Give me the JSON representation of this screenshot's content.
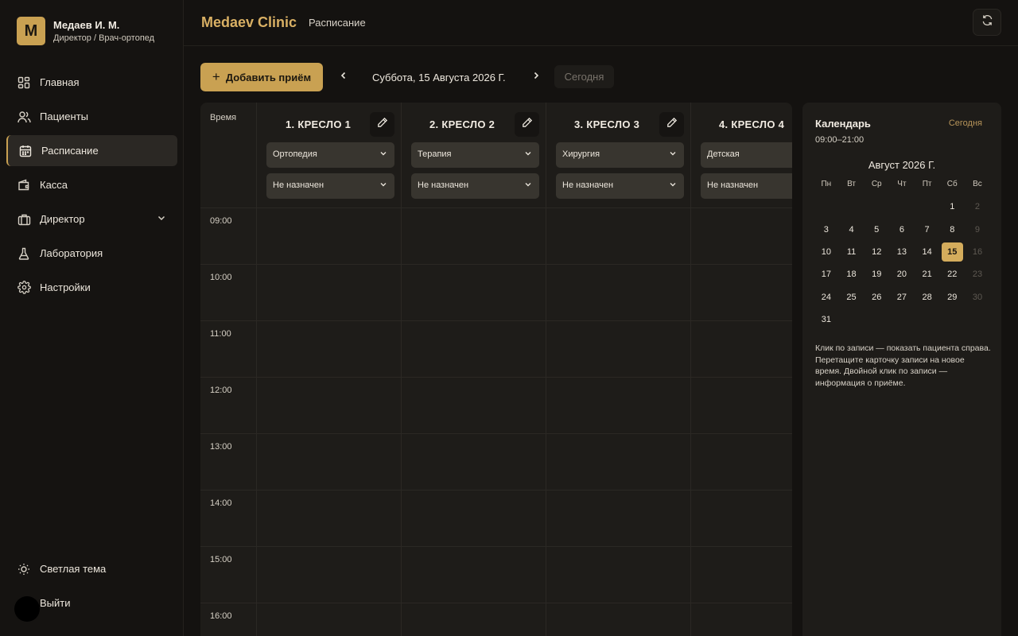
{
  "user": {
    "avatar_letter": "M",
    "name": "Медаев И. М.",
    "role": "Директор / Врач-ортопед"
  },
  "sidebar": {
    "items": [
      {
        "label": "Главная",
        "icon": "dashboard-icon"
      },
      {
        "label": "Пациенты",
        "icon": "users-icon"
      },
      {
        "label": "Расписание",
        "icon": "calendar-icon",
        "active": true
      },
      {
        "label": "Касса",
        "icon": "wallet-icon"
      },
      {
        "label": "Директор",
        "icon": "briefcase-icon",
        "expandable": true
      },
      {
        "label": "Лаборатория",
        "icon": "flask-icon"
      },
      {
        "label": "Настройки",
        "icon": "gear-icon"
      }
    ],
    "theme_label": "Светлая тема",
    "logout_label": "Выйти"
  },
  "header": {
    "brand": "Medaev Clinic",
    "breadcrumb": "Расписание"
  },
  "toolbar": {
    "add_label": "Добавить приём",
    "date_label": "Суббота, 15 Августа 2026 Г.",
    "today_label": "Сегодня"
  },
  "schedule": {
    "time_header": "Время",
    "chairs": [
      {
        "title": "1. КРЕСЛО 1",
        "specialty": "Ортопедия",
        "doctor": "Не назначен"
      },
      {
        "title": "2. КРЕСЛО 2",
        "specialty": "Терапия",
        "doctor": "Не назначен"
      },
      {
        "title": "3. КРЕСЛО 3",
        "specialty": "Хирургия",
        "doctor": "Не назначен"
      },
      {
        "title": "4. КРЕСЛО 4",
        "specialty": "Детская",
        "doctor": "Не назначен"
      }
    ],
    "hours": [
      "09:00",
      "10:00",
      "11:00",
      "12:00",
      "13:00",
      "14:00",
      "15:00",
      "16:00"
    ]
  },
  "calendar": {
    "title": "Календарь",
    "today_label": "Сегодня",
    "hours": "09:00–21:00",
    "month": "Август 2026 Г.",
    "weekdays": [
      "Пн",
      "Вт",
      "Ср",
      "Чт",
      "Пт",
      "Сб",
      "Вс"
    ],
    "weeks": [
      [
        "",
        "",
        "",
        "",
        "",
        "1",
        "2"
      ],
      [
        "3",
        "4",
        "5",
        "6",
        "7",
        "8",
        "9"
      ],
      [
        "10",
        "11",
        "12",
        "13",
        "14",
        "15",
        "16"
      ],
      [
        "17",
        "18",
        "19",
        "20",
        "21",
        "22",
        "23"
      ],
      [
        "24",
        "25",
        "26",
        "27",
        "28",
        "29",
        "30"
      ],
      [
        "31",
        "",
        "",
        "",
        "",
        "",
        ""
      ]
    ],
    "selected_day": "15",
    "help_text": "Клик по записи — показать пациента справа. Перетащите карточку записи на новое время. Двойной клик по записи — информация о приёме."
  },
  "colors": {
    "accent": "#c9a152",
    "background": "#141210",
    "panel": "#1e1c19"
  }
}
